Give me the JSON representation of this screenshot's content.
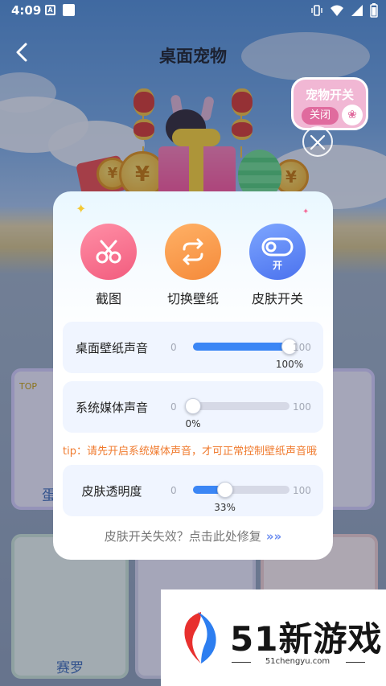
{
  "status_bar": {
    "time": "4:09",
    "badge": "A"
  },
  "header": {
    "title": "桌面宠物",
    "back_icon": "chevron-left-icon"
  },
  "pet_switch": {
    "title": "宠物开关",
    "state": "关闭"
  },
  "modal": {
    "actions": [
      {
        "label": "截图",
        "icon": "scissors-icon",
        "color": "#f25c7e"
      },
      {
        "label": "切换壁纸",
        "icon": "swap-icon",
        "color": "#f58a3a"
      },
      {
        "label": "皮肤开关",
        "icon": "toggle-icon",
        "badge": "开",
        "color": "#4b72ee"
      }
    ],
    "sliders": [
      {
        "label": "桌面壁纸声音",
        "min": "0",
        "max": "100",
        "value": 100,
        "value_text": "100%"
      },
      {
        "label": "系统媒体声音",
        "min": "0",
        "max": "100",
        "value": 0,
        "value_text": "0%"
      },
      {
        "label": "皮肤透明度",
        "min": "0",
        "max": "100",
        "value": 33,
        "value_text": "33%"
      }
    ],
    "tip": "tip：请先开启系统媒体声音，才可正常控制壁纸声音哦",
    "repair_link": "皮肤开关失效？点击此处修复",
    "repair_arrows": "»»"
  },
  "background": {
    "cards": {
      "top_tag": "TOP",
      "card1_label": "蛋",
      "card2_label": "赛罗"
    }
  },
  "watermark": {
    "brand": "51新游戏",
    "domain": "51chengyu.com"
  },
  "colors": {
    "accent_blue": "#3b86f5",
    "tip_orange": "#f07b2f"
  }
}
